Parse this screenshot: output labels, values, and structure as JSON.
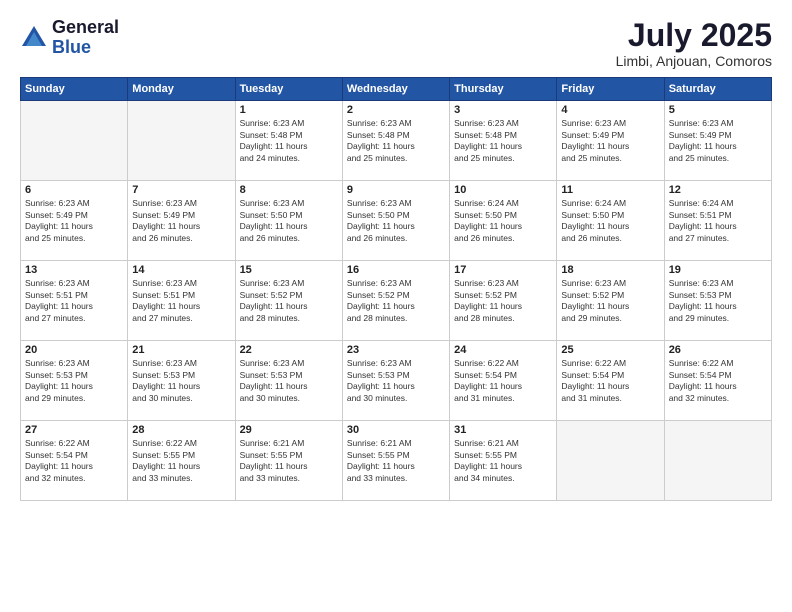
{
  "logo": {
    "general": "General",
    "blue": "Blue"
  },
  "title": {
    "month_year": "July 2025",
    "location": "Limbi, Anjouan, Comoros"
  },
  "headers": [
    "Sunday",
    "Monday",
    "Tuesday",
    "Wednesday",
    "Thursday",
    "Friday",
    "Saturday"
  ],
  "weeks": [
    [
      {
        "day": "",
        "info": ""
      },
      {
        "day": "",
        "info": ""
      },
      {
        "day": "1",
        "info": "Sunrise: 6:23 AM\nSunset: 5:48 PM\nDaylight: 11 hours\nand 24 minutes."
      },
      {
        "day": "2",
        "info": "Sunrise: 6:23 AM\nSunset: 5:48 PM\nDaylight: 11 hours\nand 25 minutes."
      },
      {
        "day": "3",
        "info": "Sunrise: 6:23 AM\nSunset: 5:48 PM\nDaylight: 11 hours\nand 25 minutes."
      },
      {
        "day": "4",
        "info": "Sunrise: 6:23 AM\nSunset: 5:49 PM\nDaylight: 11 hours\nand 25 minutes."
      },
      {
        "day": "5",
        "info": "Sunrise: 6:23 AM\nSunset: 5:49 PM\nDaylight: 11 hours\nand 25 minutes."
      }
    ],
    [
      {
        "day": "6",
        "info": "Sunrise: 6:23 AM\nSunset: 5:49 PM\nDaylight: 11 hours\nand 25 minutes."
      },
      {
        "day": "7",
        "info": "Sunrise: 6:23 AM\nSunset: 5:49 PM\nDaylight: 11 hours\nand 26 minutes."
      },
      {
        "day": "8",
        "info": "Sunrise: 6:23 AM\nSunset: 5:50 PM\nDaylight: 11 hours\nand 26 minutes."
      },
      {
        "day": "9",
        "info": "Sunrise: 6:23 AM\nSunset: 5:50 PM\nDaylight: 11 hours\nand 26 minutes."
      },
      {
        "day": "10",
        "info": "Sunrise: 6:24 AM\nSunset: 5:50 PM\nDaylight: 11 hours\nand 26 minutes."
      },
      {
        "day": "11",
        "info": "Sunrise: 6:24 AM\nSunset: 5:50 PM\nDaylight: 11 hours\nand 26 minutes."
      },
      {
        "day": "12",
        "info": "Sunrise: 6:24 AM\nSunset: 5:51 PM\nDaylight: 11 hours\nand 27 minutes."
      }
    ],
    [
      {
        "day": "13",
        "info": "Sunrise: 6:23 AM\nSunset: 5:51 PM\nDaylight: 11 hours\nand 27 minutes."
      },
      {
        "day": "14",
        "info": "Sunrise: 6:23 AM\nSunset: 5:51 PM\nDaylight: 11 hours\nand 27 minutes."
      },
      {
        "day": "15",
        "info": "Sunrise: 6:23 AM\nSunset: 5:52 PM\nDaylight: 11 hours\nand 28 minutes."
      },
      {
        "day": "16",
        "info": "Sunrise: 6:23 AM\nSunset: 5:52 PM\nDaylight: 11 hours\nand 28 minutes."
      },
      {
        "day": "17",
        "info": "Sunrise: 6:23 AM\nSunset: 5:52 PM\nDaylight: 11 hours\nand 28 minutes."
      },
      {
        "day": "18",
        "info": "Sunrise: 6:23 AM\nSunset: 5:52 PM\nDaylight: 11 hours\nand 29 minutes."
      },
      {
        "day": "19",
        "info": "Sunrise: 6:23 AM\nSunset: 5:53 PM\nDaylight: 11 hours\nand 29 minutes."
      }
    ],
    [
      {
        "day": "20",
        "info": "Sunrise: 6:23 AM\nSunset: 5:53 PM\nDaylight: 11 hours\nand 29 minutes."
      },
      {
        "day": "21",
        "info": "Sunrise: 6:23 AM\nSunset: 5:53 PM\nDaylight: 11 hours\nand 30 minutes."
      },
      {
        "day": "22",
        "info": "Sunrise: 6:23 AM\nSunset: 5:53 PM\nDaylight: 11 hours\nand 30 minutes."
      },
      {
        "day": "23",
        "info": "Sunrise: 6:23 AM\nSunset: 5:53 PM\nDaylight: 11 hours\nand 30 minutes."
      },
      {
        "day": "24",
        "info": "Sunrise: 6:22 AM\nSunset: 5:54 PM\nDaylight: 11 hours\nand 31 minutes."
      },
      {
        "day": "25",
        "info": "Sunrise: 6:22 AM\nSunset: 5:54 PM\nDaylight: 11 hours\nand 31 minutes."
      },
      {
        "day": "26",
        "info": "Sunrise: 6:22 AM\nSunset: 5:54 PM\nDaylight: 11 hours\nand 32 minutes."
      }
    ],
    [
      {
        "day": "27",
        "info": "Sunrise: 6:22 AM\nSunset: 5:54 PM\nDaylight: 11 hours\nand 32 minutes."
      },
      {
        "day": "28",
        "info": "Sunrise: 6:22 AM\nSunset: 5:55 PM\nDaylight: 11 hours\nand 33 minutes."
      },
      {
        "day": "29",
        "info": "Sunrise: 6:21 AM\nSunset: 5:55 PM\nDaylight: 11 hours\nand 33 minutes."
      },
      {
        "day": "30",
        "info": "Sunrise: 6:21 AM\nSunset: 5:55 PM\nDaylight: 11 hours\nand 33 minutes."
      },
      {
        "day": "31",
        "info": "Sunrise: 6:21 AM\nSunset: 5:55 PM\nDaylight: 11 hours\nand 34 minutes."
      },
      {
        "day": "",
        "info": ""
      },
      {
        "day": "",
        "info": ""
      }
    ]
  ]
}
